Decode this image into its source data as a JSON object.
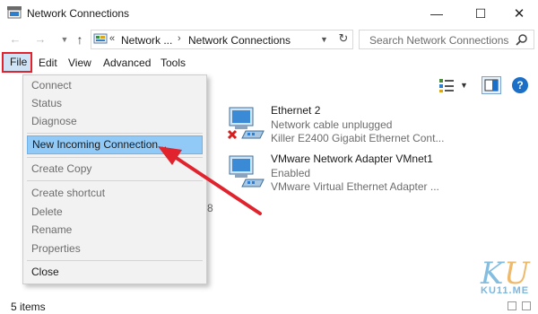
{
  "window": {
    "title": "Network Connections",
    "minimize_glyph": "—",
    "maximize_glyph": "☐",
    "close_glyph": "✕"
  },
  "address": {
    "chevron": "«",
    "crumbs": [
      "Network ...",
      "Network Connections"
    ],
    "separator": "›",
    "search_placeholder": "Search Network Connections"
  },
  "menubar": {
    "file": "File",
    "edit": "Edit",
    "view": "View",
    "advanced": "Advanced",
    "tools": "Tools"
  },
  "file_menu": {
    "items": [
      {
        "label": "Connect",
        "enabled": false
      },
      {
        "label": "Status",
        "enabled": false
      },
      {
        "label": "Diagnose",
        "enabled": false
      },
      {
        "label": "New Incoming Connection...",
        "enabled": true,
        "highlighted": true
      },
      {
        "label": "Create Copy",
        "enabled": false
      },
      {
        "label": "Create shortcut",
        "enabled": false
      },
      {
        "label": "Delete",
        "enabled": false
      },
      {
        "label": "Rename",
        "enabled": false
      },
      {
        "label": "Properties",
        "enabled": false
      },
      {
        "label": "Close",
        "enabled": true
      }
    ]
  },
  "connections": [
    {
      "name": "Ethernet 2",
      "status": "Network cable unplugged",
      "device": "Killer E2400 Gigabit Ethernet Cont...",
      "icon": "network-adapter-disconnected-icon"
    },
    {
      "name": "VMware Network Adapter VMnet1",
      "status": "Enabled",
      "device": "VMware Virtual Ethernet Adapter ...",
      "icon": "network-adapter-icon"
    }
  ],
  "partial_text": "8",
  "statusbar": {
    "count": "5 items"
  },
  "watermark": {
    "logo": "KU",
    "text": "KU11.ME"
  },
  "colors": {
    "accent_red": "#e0232d",
    "highlight": "#91c9f7",
    "help_blue": "#1b6fc7"
  }
}
